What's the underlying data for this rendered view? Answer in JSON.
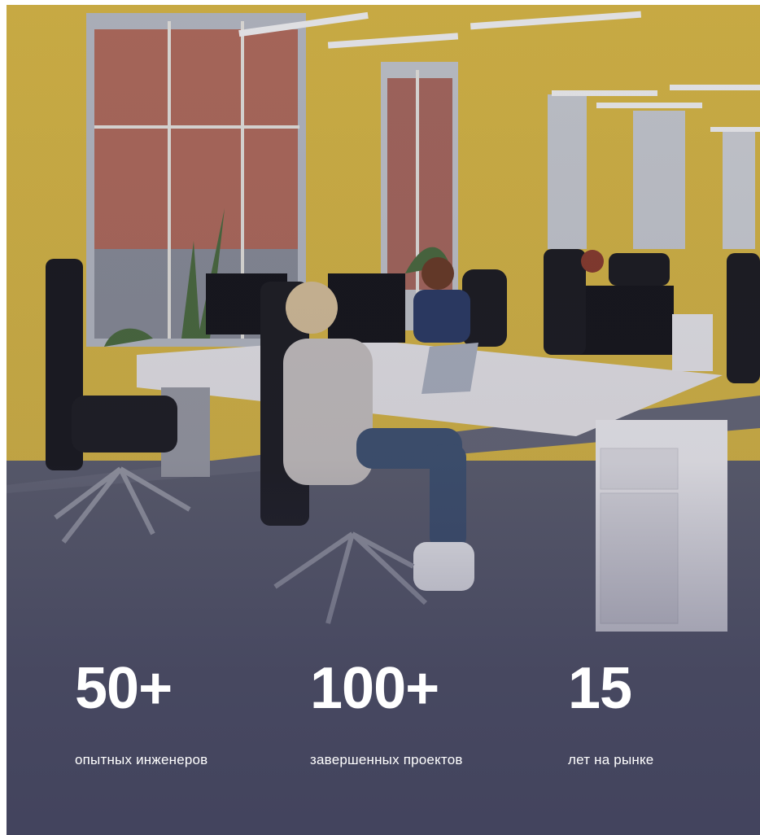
{
  "hero": {
    "image_icon": "office-photo",
    "stats": [
      {
        "value": "50+",
        "label": "опытных инженеров"
      },
      {
        "value": "100+",
        "label": "завершенных проектов"
      },
      {
        "value": "15",
        "label": "лет на рынке"
      }
    ]
  },
  "colors": {
    "wall_yellow": "#e3c24a",
    "floor": "#5a5c6b",
    "text": "#ffffff"
  }
}
